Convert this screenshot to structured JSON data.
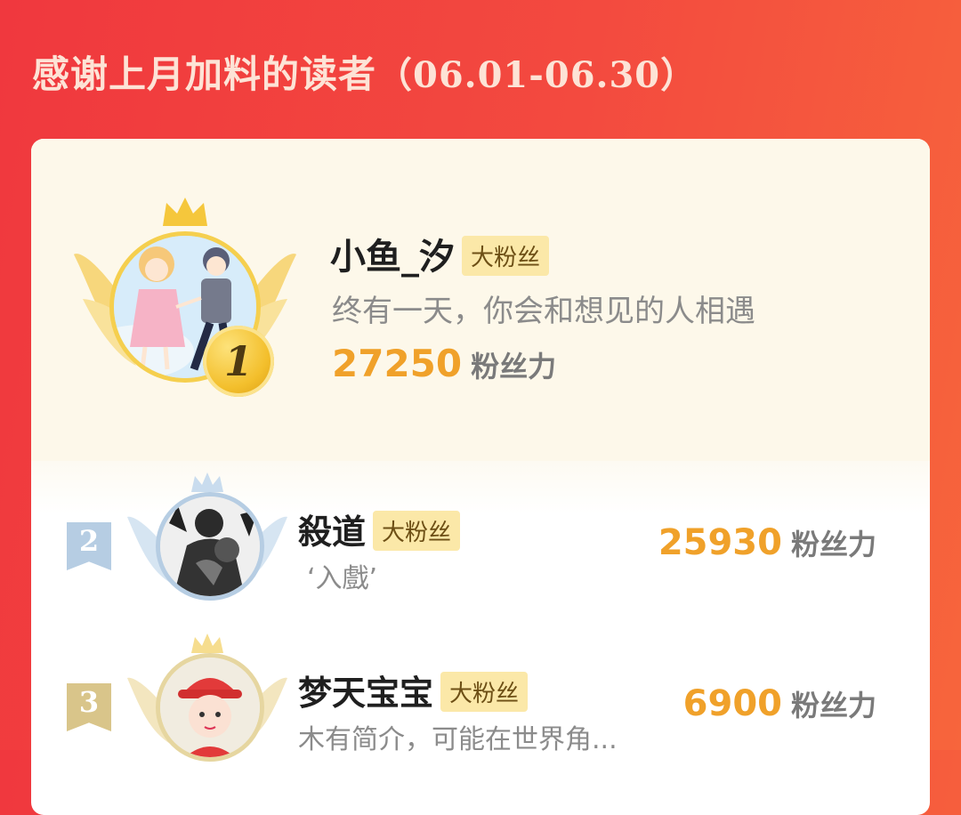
{
  "header": {
    "title": "感谢上月加料的读者",
    "date_range": "（06.01-06.30）"
  },
  "colors": {
    "accent": "#f0a12a",
    "background_red": "#f0383e",
    "badge_bg": "#fbe8a8"
  },
  "leaderboard": {
    "first": {
      "rank": "1",
      "name": "小鱼_汐",
      "badge": "大粉丝",
      "signature": "终有一天，你会和想见的人相遇",
      "score": "27250",
      "score_label": "粉丝力"
    },
    "rows": [
      {
        "rank": "2",
        "name": "殺道",
        "badge": "大粉丝",
        "signature": "‘入戲’",
        "score": "25930",
        "score_label": "粉丝力"
      },
      {
        "rank": "3",
        "name": "梦天宝宝",
        "badge": "大粉丝",
        "signature": "木有简介，可能在世界角...",
        "score": "6900",
        "score_label": "粉丝力"
      }
    ]
  }
}
